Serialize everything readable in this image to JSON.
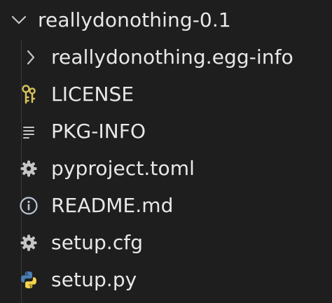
{
  "explorer": {
    "root_folder": {
      "name": "reallydonothing-0.1",
      "icon": "chevron-down-icon"
    },
    "items": [
      {
        "name": "reallydonothing.egg-info",
        "icon": "chevron-right-icon",
        "kind": "folder"
      },
      {
        "name": "LICENSE",
        "icon": "key-icon",
        "kind": "file"
      },
      {
        "name": "PKG-INFO",
        "icon": "lines-icon",
        "kind": "file"
      },
      {
        "name": "pyproject.toml",
        "icon": "gear-icon",
        "kind": "file"
      },
      {
        "name": "README.md",
        "icon": "info-icon",
        "kind": "file"
      },
      {
        "name": "setup.cfg",
        "icon": "gear-icon",
        "kind": "file"
      },
      {
        "name": "setup.py",
        "icon": "python-icon",
        "kind": "file"
      }
    ],
    "colors": {
      "background": "#1e1e1f",
      "text": "#e8e8e8",
      "icon_gray": "#c5c5c5",
      "key_yellow": "#d9c45a",
      "info_blue": "#b9c4d6",
      "python_blue": "#4a7fb5",
      "python_yellow": "#f2d44a"
    }
  }
}
